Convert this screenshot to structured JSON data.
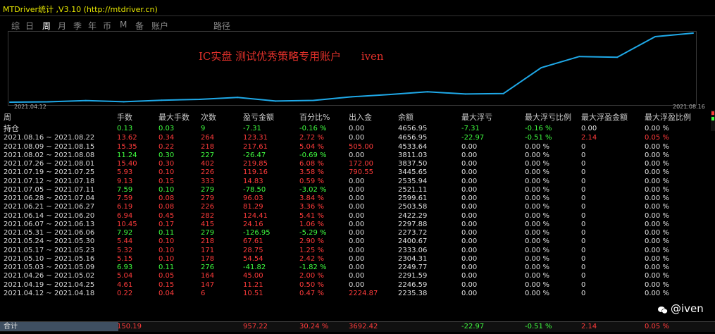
{
  "window": {
    "title": "MTDriver统计 ,V3.10 (http://mtdriver.cn)"
  },
  "tabs": [
    {
      "label": "综"
    },
    {
      "label": "日"
    },
    {
      "label": "周"
    },
    {
      "label": "月"
    },
    {
      "label": "季"
    },
    {
      "label": "年"
    },
    {
      "label": "币"
    },
    {
      "label": "M"
    },
    {
      "label": "备"
    },
    {
      "label": "账户"
    },
    {
      "label": "路径"
    }
  ],
  "chart": {
    "title": "IC实盘 测试优秀策略专用账户      iven",
    "start_date": "2021.04.12",
    "end_date": "2021.08.16",
    "line_color": "#1fa9e8"
  },
  "chart_data": {
    "type": "line",
    "title": "IC实盘 测试优秀策略专用账户      iven",
    "x": [
      "2021.04.12",
      "2021.04.19",
      "2021.04.26",
      "2021.05.03",
      "2021.05.10",
      "2021.05.17",
      "2021.05.24",
      "2021.05.31",
      "2021.06.07",
      "2021.06.14",
      "2021.06.21",
      "2021.06.28",
      "2021.07.05",
      "2021.07.12",
      "2021.07.19",
      "2021.07.26",
      "2021.08.02",
      "2021.08.09",
      "2021.08.16"
    ],
    "values": [
      2235.38,
      2246.59,
      2291.59,
      2249.77,
      2304.31,
      2333.06,
      2400.67,
      2273.72,
      2297.88,
      2422.29,
      2503.58,
      2599.61,
      2521.11,
      2535.94,
      3445.65,
      3837.5,
      3811.03,
      4533.64,
      4656.95
    ],
    "grid": false
  },
  "table": {
    "headers": [
      "周",
      "手数",
      "最大手数",
      "次数",
      "盈亏金额",
      "百分比%",
      "出入金",
      "余额",
      "最大浮亏",
      "最大浮亏比例",
      "最大浮盈金额",
      "最大浮盈比例"
    ],
    "holding": {
      "label": "持仓",
      "cells": [
        "0.13",
        "0.03",
        "9",
        "-7.31",
        "-0.16 %",
        "0.00",
        "4656.95",
        "-7.31",
        "-0.16 %",
        "0.00",
        "0.00 %"
      ]
    },
    "rows": [
      {
        "week": "2021.08.16 ~ 2021.08.22",
        "cells": [
          "13.62",
          "0.34",
          "264",
          "123.31",
          "2.72 %",
          "0.00",
          "4656.95",
          "-22.97",
          "-0.51 %",
          "2.14",
          "0.05 %"
        ],
        "sign": "pos",
        "mfe": "pos"
      },
      {
        "week": "2021.08.09 ~ 2021.08.15",
        "cells": [
          "15.35",
          "0.22",
          "218",
          "217.61",
          "5.04 %",
          "505.00",
          "4533.64",
          "0.00",
          "0.00 %",
          "0",
          "0.00 %"
        ],
        "sign": "pos",
        "flow": "pos"
      },
      {
        "week": "2021.08.02 ~ 2021.08.08",
        "cells": [
          "11.24",
          "0.30",
          "227",
          "-26.47",
          "-0.69 %",
          "0.00",
          "3811.03",
          "0.00",
          "0.00 %",
          "0",
          "0.00 %"
        ],
        "sign": "neg"
      },
      {
        "week": "2021.07.26 ~ 2021.08.01",
        "cells": [
          "15.40",
          "0.30",
          "402",
          "219.85",
          "6.08 %",
          "172.00",
          "3837.50",
          "0.00",
          "0.00 %",
          "0",
          "0.00 %"
        ],
        "sign": "pos",
        "flow": "pos"
      },
      {
        "week": "2021.07.19 ~ 2021.07.25",
        "cells": [
          "5.93",
          "0.10",
          "226",
          "119.16",
          "3.58 %",
          "790.55",
          "3445.65",
          "0.00",
          "0.00 %",
          "0",
          "0.00 %"
        ],
        "sign": "pos",
        "flow": "pos"
      },
      {
        "week": "2021.07.12 ~ 2021.07.18",
        "cells": [
          "9.13",
          "0.15",
          "333",
          "14.83",
          "0.59 %",
          "0.00",
          "2535.94",
          "0.00",
          "0.00 %",
          "0",
          "0.00 %"
        ],
        "sign": "pos"
      },
      {
        "week": "2021.07.05 ~ 2021.07.11",
        "cells": [
          "7.59",
          "0.10",
          "279",
          "-78.50",
          "-3.02 %",
          "0.00",
          "2521.11",
          "0.00",
          "0.00 %",
          "0",
          "0.00 %"
        ],
        "sign": "neg"
      },
      {
        "week": "2021.06.28 ~ 2021.07.04",
        "cells": [
          "7.59",
          "0.08",
          "279",
          "96.03",
          "3.84 %",
          "0.00",
          "2599.61",
          "0.00",
          "0.00 %",
          "0",
          "0.00 %"
        ],
        "sign": "pos"
      },
      {
        "week": "2021.06.21 ~ 2021.06.27",
        "cells": [
          "6.19",
          "0.08",
          "226",
          "81.29",
          "3.36 %",
          "0.00",
          "2503.58",
          "0.00",
          "0.00 %",
          "0",
          "0.00 %"
        ],
        "sign": "pos"
      },
      {
        "week": "2021.06.14 ~ 2021.06.20",
        "cells": [
          "6.94",
          "0.45",
          "282",
          "124.41",
          "5.41 %",
          "0.00",
          "2422.29",
          "0.00",
          "0.00 %",
          "0",
          "0.00 %"
        ],
        "sign": "pos"
      },
      {
        "week": "2021.06.07 ~ 2021.06.13",
        "cells": [
          "10.45",
          "0.17",
          "415",
          "24.16",
          "1.06 %",
          "0.00",
          "2297.88",
          "0.00",
          "0.00 %",
          "0",
          "0.00 %"
        ],
        "sign": "pos"
      },
      {
        "week": "2021.05.31 ~ 2021.06.06",
        "cells": [
          "7.92",
          "0.11",
          "279",
          "-126.95",
          "-5.29 %",
          "0.00",
          "2273.72",
          "0.00",
          "0.00 %",
          "0",
          "0.00 %"
        ],
        "sign": "neg"
      },
      {
        "week": "2021.05.24 ~ 2021.05.30",
        "cells": [
          "5.44",
          "0.10",
          "218",
          "67.61",
          "2.90 %",
          "0.00",
          "2400.67",
          "0.00",
          "0.00 %",
          "0",
          "0.00 %"
        ],
        "sign": "pos"
      },
      {
        "week": "2021.05.17 ~ 2021.05.23",
        "cells": [
          "5.32",
          "0.10",
          "171",
          "28.75",
          "1.25 %",
          "0.00",
          "2333.06",
          "0.00",
          "0.00 %",
          "0",
          "0.00 %"
        ],
        "sign": "pos"
      },
      {
        "week": "2021.05.10 ~ 2021.05.16",
        "cells": [
          "5.15",
          "0.10",
          "178",
          "54.54",
          "2.42 %",
          "0.00",
          "2304.31",
          "0.00",
          "0.00 %",
          "0",
          "0.00 %"
        ],
        "sign": "pos"
      },
      {
        "week": "2021.05.03 ~ 2021.05.09",
        "cells": [
          "6.93",
          "0.11",
          "276",
          "-41.82",
          "-1.82 %",
          "0.00",
          "2249.77",
          "0.00",
          "0.00 %",
          "0",
          "0.00 %"
        ],
        "sign": "neg"
      },
      {
        "week": "2021.04.26 ~ 2021.05.02",
        "cells": [
          "5.04",
          "0.05",
          "164",
          "45.00",
          "2.00 %",
          "0.00",
          "2291.59",
          "0.00",
          "0.00 %",
          "0",
          "0.00 %"
        ],
        "sign": "pos"
      },
      {
        "week": "2021.04.19 ~ 2021.04.25",
        "cells": [
          "4.61",
          "0.15",
          "147",
          "11.21",
          "0.50 %",
          "0.00",
          "2246.59",
          "0.00",
          "0.00 %",
          "0",
          "0.00 %"
        ],
        "sign": "pos"
      },
      {
        "week": "2021.04.12 ~ 2021.04.18",
        "cells": [
          "0.22",
          "0.04",
          "6",
          "10.51",
          "0.47 %",
          "2224.87",
          "2235.38",
          "0.00",
          "0.00 %",
          "0",
          "0.00 %"
        ],
        "sign": "pos",
        "flow": "pos"
      }
    ],
    "total": {
      "label": "合计",
      "cells": [
        "150.19",
        "",
        "",
        "957.22",
        "30.24 %",
        "3692.42",
        "",
        "-22.97",
        "-0.51 %",
        "2.14",
        "0.05 %"
      ]
    }
  },
  "watermark": {
    "text": "@iven"
  },
  "colors": {
    "positive": "#ff3b3b",
    "negative": "#40ff40",
    "accent": "#1fa9e8",
    "title": "#e8e800"
  }
}
